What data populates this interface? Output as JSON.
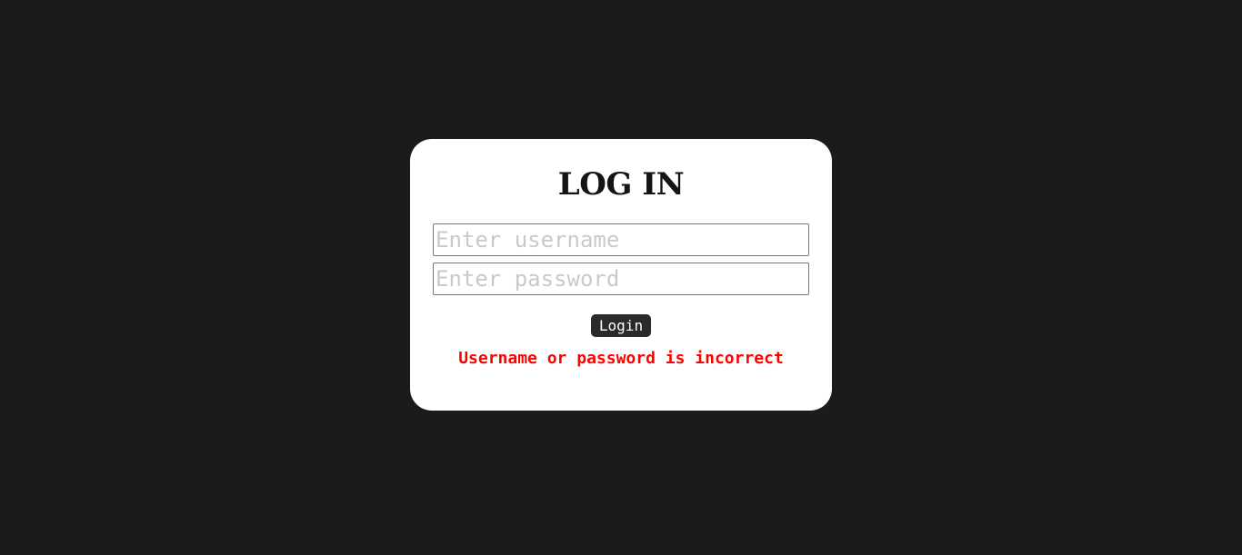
{
  "login": {
    "title": "LOG IN",
    "username_placeholder": "Enter username",
    "password_placeholder": "Enter password",
    "button_label": "Login",
    "error_message": "Username or password is incorrect"
  },
  "colors": {
    "background": "#1b1b1b",
    "card": "#ffffff",
    "button": "#2a2a2a",
    "error": "#ff0000"
  }
}
